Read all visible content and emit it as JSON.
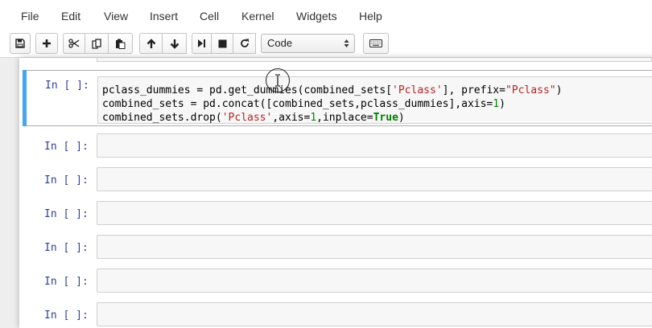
{
  "menubar": {
    "items": [
      "File",
      "Edit",
      "View",
      "Insert",
      "Cell",
      "Kernel",
      "Widgets",
      "Help"
    ]
  },
  "toolbar": {
    "buttons": [
      "save-icon",
      "plus-icon",
      "scissors-icon",
      "copy-icon",
      "paste-icon",
      "arrow-up-icon",
      "arrow-down-icon",
      "step-forward-icon",
      "stop-icon",
      "restart-icon",
      "keyboard-icon"
    ],
    "cell_type": "Code"
  },
  "cells": {
    "selected": {
      "prompt": "In [ ]:",
      "lines": {
        "l1": {
          "a": "pclass_dummies = pd.get_dummies(combined_sets[",
          "b": "'Pclass'",
          "c": "], prefix=",
          "d": "\"Pclass\"",
          "e": ")"
        },
        "l2": {
          "a": "combined_sets = pd.concat([combined_sets,pclass_dummies],axis=",
          "b": "1",
          "c": ")"
        },
        "l3": {
          "a": "combined_sets.drop(",
          "b": "'Pclass'",
          "c": ",axis=",
          "d": "1",
          "e": ",inplace=",
          "f": "True",
          "g": ")"
        }
      }
    },
    "empty_prompts": [
      "In [ ]:",
      "In [ ]:",
      "In [ ]:",
      "In [ ]:",
      "In [ ]:",
      "In [ ]:"
    ]
  },
  "colors": {
    "selection_bar": "#42a5f5",
    "prompt": "#303f9f",
    "string": "#ba2121",
    "number": "#008800"
  }
}
